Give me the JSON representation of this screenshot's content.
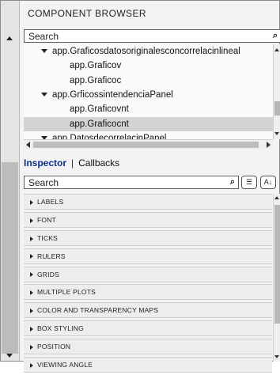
{
  "component_browser": {
    "title": "COMPONENT BROWSER",
    "search_placeholder": "Search",
    "tree": [
      {
        "label": "app.Graficosdatosoriginalesconcorrelacinlineal",
        "level": 0,
        "expanded": true,
        "selected": false
      },
      {
        "label": "app.Graficov",
        "level": 1,
        "expanded": false,
        "selected": false
      },
      {
        "label": "app.Graficoc",
        "level": 1,
        "expanded": false,
        "selected": false
      },
      {
        "label": "app.GrficossintendenciaPanel",
        "level": 0,
        "expanded": true,
        "selected": false
      },
      {
        "label": "app.Graficovnt",
        "level": 1,
        "expanded": false,
        "selected": false
      },
      {
        "label": "app.Graficocnt",
        "level": 1,
        "expanded": false,
        "selected": true
      },
      {
        "label": "app.DatosdecorrelacinPanel",
        "level": 0,
        "expanded": true,
        "selected": false
      }
    ]
  },
  "inspector": {
    "tabs": {
      "active": "Inspector",
      "separator": "|",
      "other": "Callbacks"
    },
    "search_placeholder": "Search",
    "sections": [
      "LABELS",
      "FONT",
      "TICKS",
      "RULERS",
      "GRIDS",
      "MULTIPLE PLOTS",
      "COLOR AND TRANSPARENCY MAPS",
      "BOX STYLING",
      "POSITION",
      "VIEWING ANGLE"
    ]
  },
  "icons": {
    "search": "magnifier-icon",
    "sort_category": "list-view-icon",
    "sort_alpha": "sort-az-icon"
  }
}
